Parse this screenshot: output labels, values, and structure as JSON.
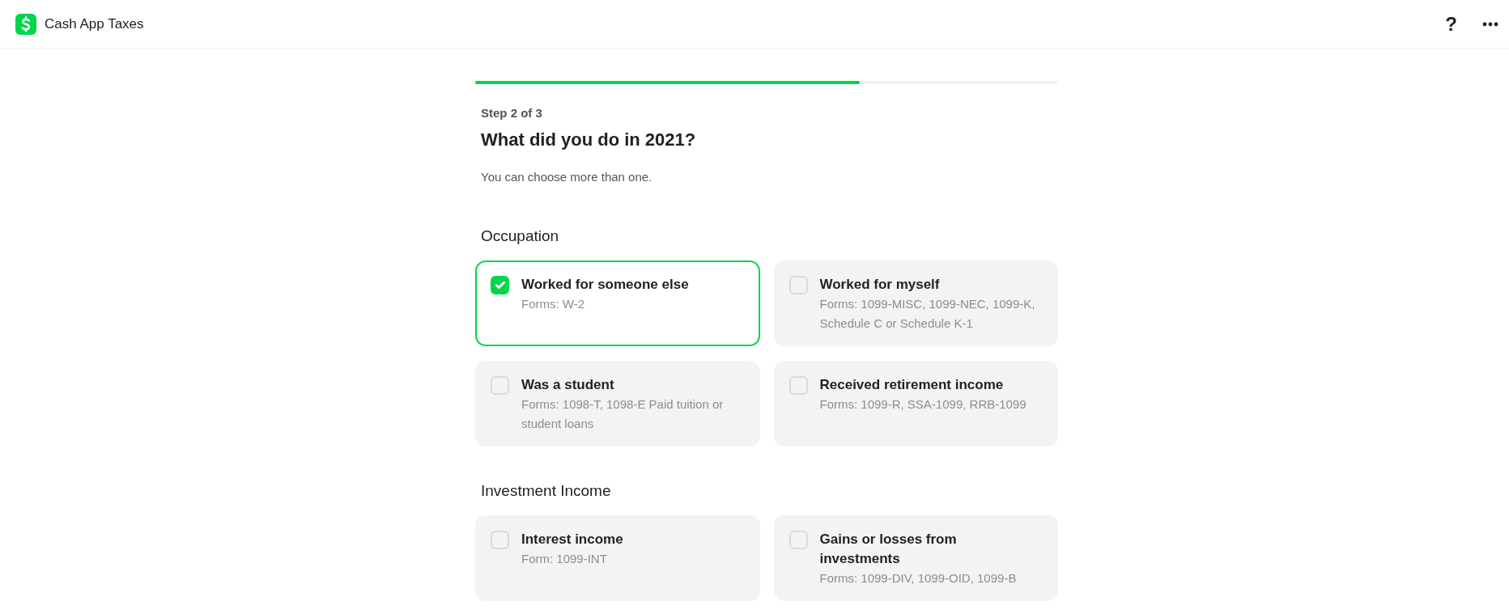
{
  "header": {
    "title": "Cash App Taxes",
    "help_label": "?"
  },
  "progress": {
    "level": 0.66
  },
  "step": "Step 2 of 3",
  "heading": "What did you do in 2021?",
  "hint": "You can choose more than one.",
  "sections": [
    {
      "title": "Occupation",
      "options": [
        {
          "title": "Worked for someone else",
          "forms": "Forms: W-2",
          "checked": true
        },
        {
          "title": "Worked for myself",
          "forms": "Forms: 1099-MISC, 1099-NEC, 1099-K, Schedule C or Schedule K-1",
          "checked": false
        },
        {
          "title": "Was a student",
          "forms": "Forms: 1098-T, 1098-E Paid tuition or student loans",
          "checked": false
        },
        {
          "title": "Received retirement income",
          "forms": "Forms: 1099-R, SSA-1099, RRB-1099",
          "checked": false
        }
      ]
    },
    {
      "title": "Investment Income",
      "options": [
        {
          "title": "Interest income",
          "forms": "Form: 1099-INT",
          "checked": false
        },
        {
          "title": "Gains or losses from investments",
          "forms": "Forms: 1099-DIV, 1099-OID, 1099-B",
          "checked": false
        }
      ]
    }
  ]
}
